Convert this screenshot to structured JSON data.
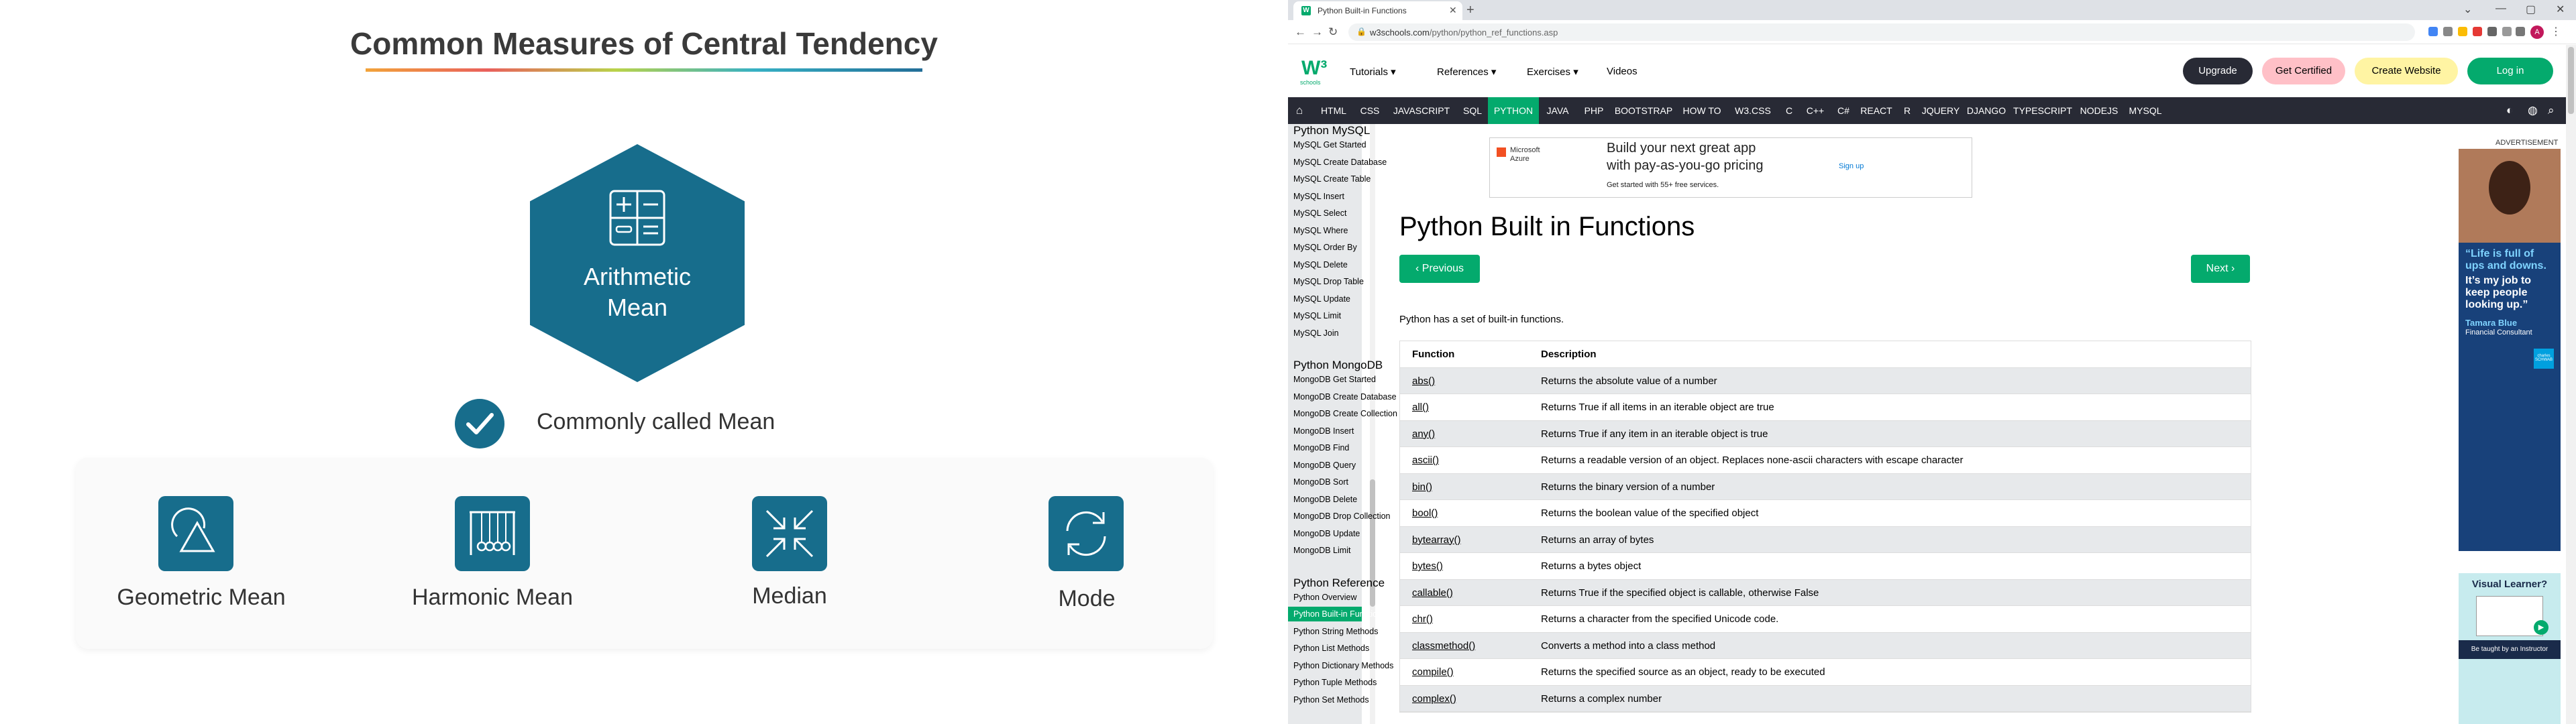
{
  "slide": {
    "title": "Common Measures of Central Tendency",
    "center_label_line1": "Arithmetic",
    "center_label_line2": "Mean",
    "check_label": "Commonly called Mean",
    "measures": [
      "Geometric Mean",
      "Harmonic Mean",
      "Median",
      "Mode"
    ],
    "accent_color": "#176d8c"
  },
  "browser": {
    "tab_title": "Python Built-in Functions",
    "url_domain": "w3schools.com",
    "url_path": "/python/python_ref_functions.asp",
    "profile_initial": "A"
  },
  "w3": {
    "logo_sub": "schools",
    "menus": [
      "Tutorials",
      "References",
      "Exercises",
      "Videos"
    ],
    "buttons": {
      "upgrade": "Upgrade",
      "certified": "Get Certified",
      "create": "Create Website",
      "login": "Log in"
    },
    "topnav": [
      "HTML",
      "CSS",
      "JAVASCRIPT",
      "SQL",
      "PYTHON",
      "JAVA",
      "PHP",
      "BOOTSTRAP",
      "HOW TO",
      "W3.CSS",
      "C",
      "C++",
      "C#",
      "REACT",
      "R",
      "JQUERY",
      "DJANGO",
      "TYPESCRIPT",
      "NODEJS",
      "MYSQL"
    ],
    "active_topnav": "PYTHON",
    "brand_color": "#04aa6d"
  },
  "sidebar": {
    "mysql_head": "Python MySQL",
    "mysql_links": [
      "MySQL Get Started",
      "MySQL Create Database",
      "MySQL Create Table",
      "MySQL Insert",
      "MySQL Select",
      "MySQL Where",
      "MySQL Order By",
      "MySQL Delete",
      "MySQL Drop Table",
      "MySQL Update",
      "MySQL Limit",
      "MySQL Join"
    ],
    "mongo_head": "Python MongoDB",
    "mongo_links": [
      "MongoDB Get Started",
      "MongoDB Create Database",
      "MongoDB Create Collection",
      "MongoDB Insert",
      "MongoDB Find",
      "MongoDB Query",
      "MongoDB Sort",
      "MongoDB Delete",
      "MongoDB Drop Collection",
      "MongoDB Update",
      "MongoDB Limit"
    ],
    "ref_head": "Python Reference",
    "ref_links": [
      "Python Overview",
      "Python Built-in Functions",
      "Python String Methods",
      "Python List Methods",
      "Python Dictionary Methods",
      "Python Tuple Methods",
      "Python Set Methods"
    ],
    "active_link": "Python Built-in Functions"
  },
  "main": {
    "ad_line1": "Build your next great app",
    "ad_line2": "with pay-as-you-go pricing",
    "ad_line3": "Get started with 55+ free services.",
    "ad_signup": "Sign up",
    "ad_brand": "Microsoft Azure",
    "heading": "Python Built in Functions",
    "prev": "Previous",
    "next": "Next",
    "intro": "Python has a set of built-in functions.",
    "table_head": {
      "name": "Function",
      "desc": "Description"
    },
    "rows": [
      {
        "name": "abs()",
        "desc": "Returns the absolute value of a number"
      },
      {
        "name": "all()",
        "desc": "Returns True if all items in an iterable object are true"
      },
      {
        "name": "any()",
        "desc": "Returns True if any item in an iterable object is true"
      },
      {
        "name": "ascii()",
        "desc": "Returns a readable version of an object. Replaces none-ascii characters with escape character"
      },
      {
        "name": "bin()",
        "desc": "Returns the binary version of a number"
      },
      {
        "name": "bool()",
        "desc": "Returns the boolean value of the specified object"
      },
      {
        "name": "bytearray()",
        "desc": "Returns an array of bytes"
      },
      {
        "name": "bytes()",
        "desc": "Returns a bytes object"
      },
      {
        "name": "callable()",
        "desc": "Returns True if the specified object is callable, otherwise False"
      },
      {
        "name": "chr()",
        "desc": "Returns a character from the specified Unicode code."
      },
      {
        "name": "classmethod()",
        "desc": "Converts a method into a class method"
      },
      {
        "name": "compile()",
        "desc": "Returns the specified source as an object, ready to be executed"
      },
      {
        "name": "complex()",
        "desc": "Returns a complex number"
      }
    ]
  },
  "ads": {
    "label": "ADVERTISEMENT",
    "quote1": "“Life is full of ups and downs.",
    "quote2": "It’s my job to keep people looking up.”",
    "person": "Tamara Blue",
    "role": "Financial Consultant",
    "brand": "charles SCHWAB",
    "visual_title": "Visual Learner?",
    "visual_sub": "Be taught by an Instructor"
  }
}
